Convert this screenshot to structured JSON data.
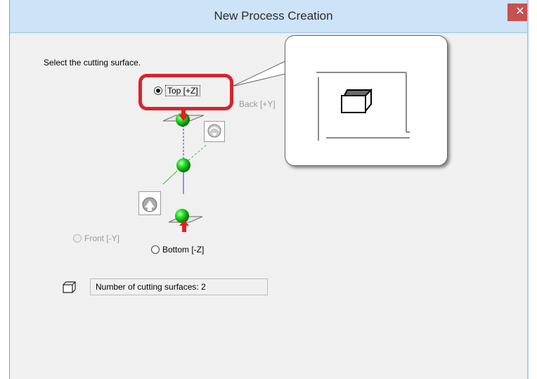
{
  "window": {
    "title": "New Process Creation",
    "close_glyph": "✕",
    "accent_color": "#d9232b"
  },
  "prompt": "Select the cutting surface.",
  "surfaces": {
    "top": {
      "label": "Top [+Z]",
      "selected": true,
      "enabled": true
    },
    "back": {
      "label": "Back [+Y]",
      "selected": false,
      "enabled": false
    },
    "front": {
      "label": "Front [-Y]",
      "selected": false,
      "enabled": false
    },
    "bottom": {
      "label": "Bottom [-Z]",
      "selected": false,
      "enabled": true
    }
  },
  "icons": [
    "close-icon",
    "rotate-view-icon",
    "cube-icon",
    "axis-sphere-icon"
  ],
  "count": {
    "text": "Number of cutting surfaces: 2"
  }
}
